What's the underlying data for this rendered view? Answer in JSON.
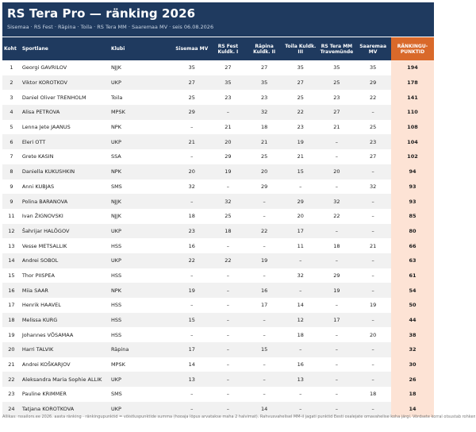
{
  "header": {
    "title": "RS Tera Pro — ränking 2026",
    "subtitle": "Sisemaa · RS Fest · Räpina · Toila · RS Tera MM · Saaremaa MV · seis 06.08.2026"
  },
  "table": {
    "columns": [
      {
        "key": "koht",
        "label": "Koht"
      },
      {
        "key": "sportlane",
        "label": "Sportlane"
      },
      {
        "key": "klubi",
        "label": "Klubi"
      },
      {
        "key": "sisemaa",
        "label": "Sisemaa MV"
      },
      {
        "key": "rsfest",
        "label": "RS Fest Kuldk. I"
      },
      {
        "key": "rapina",
        "label": "Räpina Kuldk. II"
      },
      {
        "key": "toila",
        "label": "Toila Kuldk. III"
      },
      {
        "key": "rstera",
        "label": "RS Tera MM Travemünde"
      },
      {
        "key": "saaremaa",
        "label": "Saaremaa MV"
      },
      {
        "key": "punktid",
        "label": "RÄNKINGU-PUNKTID"
      }
    ],
    "rows": [
      [
        "1",
        "Georgi GAVRILOV",
        "NJJK",
        "35",
        "27",
        "27",
        "35",
        "35",
        "35",
        "194"
      ],
      [
        "2",
        "Viktor KOROTKOV",
        "UKP",
        "27",
        "35",
        "35",
        "27",
        "25",
        "29",
        "178"
      ],
      [
        "3",
        "Daniel Oliver TRENHOLM",
        "Toila",
        "25",
        "23",
        "23",
        "25",
        "23",
        "22",
        "141"
      ],
      [
        "4",
        "Alisa PETROVA",
        "MPSK",
        "29",
        "–",
        "32",
        "22",
        "27",
        "–",
        "110"
      ],
      [
        "5",
        "Lenna Jete JAANUS",
        "NPK",
        "–",
        "21",
        "18",
        "23",
        "21",
        "25",
        "108"
      ],
      [
        "6",
        "Eleri OTT",
        "UKP",
        "21",
        "20",
        "21",
        "19",
        "–",
        "23",
        "104"
      ],
      [
        "7",
        "Grete KASIN",
        "SSA",
        "–",
        "29",
        "25",
        "21",
        "–",
        "27",
        "102"
      ],
      [
        "8",
        "Daniella KUKUSHKIN",
        "NPK",
        "20",
        "19",
        "20",
        "15",
        "20",
        "–",
        "94"
      ],
      [
        "9",
        "Anni KUBJAS",
        "SMS",
        "32",
        "–",
        "29",
        "–",
        "–",
        "32",
        "93"
      ],
      [
        "9",
        "Polina BARANOVA",
        "NJJK",
        "–",
        "32",
        "–",
        "29",
        "32",
        "–",
        "93"
      ],
      [
        "11",
        "Ivan ŽIGNOVSKI",
        "NJJK",
        "18",
        "25",
        "–",
        "20",
        "22",
        "–",
        "85"
      ],
      [
        "12",
        "Šahrijar HALÕGOV",
        "UKP",
        "23",
        "18",
        "22",
        "17",
        "–",
        "–",
        "80"
      ],
      [
        "13",
        "Vesse METSALLIK",
        "HSS",
        "16",
        "–",
        "–",
        "11",
        "18",
        "21",
        "66"
      ],
      [
        "14",
        "Andrei SOBOL",
        "UKP",
        "22",
        "22",
        "19",
        "–",
        "–",
        "–",
        "63"
      ],
      [
        "15",
        "Thor PIISPEA",
        "HSS",
        "–",
        "–",
        "–",
        "32",
        "29",
        "–",
        "61"
      ],
      [
        "16",
        "Miia SAAR",
        "NPK",
        "19",
        "–",
        "16",
        "–",
        "19",
        "–",
        "54"
      ],
      [
        "17",
        "Henrik HAAVEL",
        "HSS",
        "–",
        "–",
        "17",
        "14",
        "–",
        "19",
        "50"
      ],
      [
        "18",
        "Melissa KURG",
        "HSS",
        "15",
        "–",
        "–",
        "12",
        "17",
        "–",
        "44"
      ],
      [
        "19",
        "Johannes VÕSAMAA",
        "HSS",
        "–",
        "–",
        "–",
        "18",
        "–",
        "20",
        "38"
      ],
      [
        "20",
        "Harri TALVIK",
        "Räpina",
        "17",
        "–",
        "15",
        "–",
        "–",
        "–",
        "32"
      ],
      [
        "21",
        "Andrei KOŠKARJOV",
        "MPSK",
        "14",
        "–",
        "–",
        "16",
        "–",
        "–",
        "30"
      ],
      [
        "22",
        "Aleksandra Maria Sophie ALLIK",
        "UKP",
        "13",
        "–",
        "–",
        "13",
        "–",
        "–",
        "26"
      ],
      [
        "23",
        "Pauline KRIMMER",
        "SMS",
        "–",
        "–",
        "–",
        "–",
        "–",
        "18",
        "18"
      ],
      [
        "24",
        "Tatjana KOROTKOVA",
        "UKP",
        "–",
        "–",
        "14",
        "–",
        "–",
        "–",
        "14"
      ]
    ]
  },
  "footnote": "Allikas: rssailors.ee 2026. aasta ränking · ränkingupunktid = võistluspunktide summa (hooaja lõpus arvatakse maha 2 halvimat). Rahvusvahelisel MM-il jagati punktid Eesti osalejate omavahelise koha järgi. Võrdsete korral otsustab rohkem esikohti.",
  "colors": {
    "header_bg": "#1f3a5f",
    "rank_header_bg": "#d9692a",
    "rank_cell_bg": "#fde3d5",
    "stripe_bg": "#f1f1f1"
  }
}
